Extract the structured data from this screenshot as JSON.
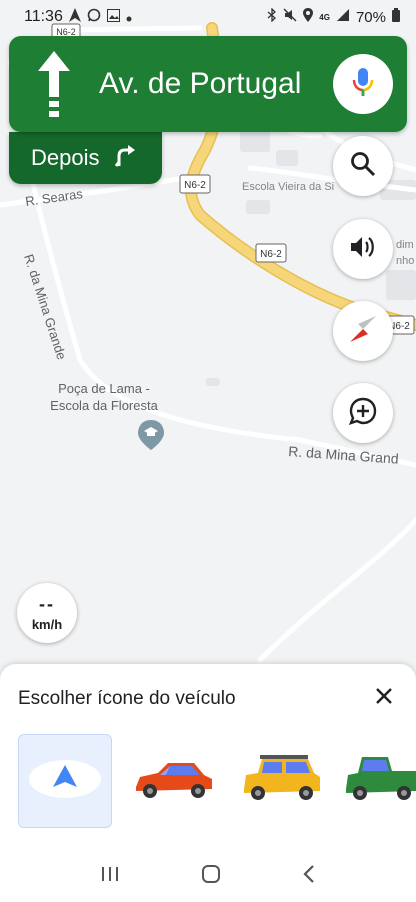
{
  "status_bar": {
    "time": "11:36",
    "battery": "70%",
    "network": "4G",
    "left_icons": [
      "navigation-arrow-icon",
      "whatsapp-icon",
      "gallery-icon",
      "dot-icon"
    ],
    "right_icons": [
      "bluetooth-icon",
      "mute-icon",
      "location-icon",
      "network-icon",
      "signal-icon",
      "battery-icon"
    ]
  },
  "navigation": {
    "direction": "straight",
    "street": "Av. de Portugal",
    "then_label": "Depois",
    "then_icon": "turn-right-icon"
  },
  "map": {
    "labels": {
      "road_n62_a": "N6-2",
      "road_n62_b": "N6-2",
      "road_n62_c": "N6-2",
      "road_n62_top": "N6-2",
      "searas": "R. Searas",
      "mina_grande_vertical": "R. da Mina Grande",
      "mina_grande_horizontal": "R. da Mina Grand",
      "escola_vieira": "Escola Vieira da Si",
      "poca_line1": "Poça de Lama -",
      "poca_line2": "Escola da Floresta",
      "jardim_line1": "dim",
      "jardim_line2": "nho"
    },
    "colors": {
      "background": "#f1f3f4",
      "road": "#ffffff",
      "highway": "#f6d67a",
      "highway_border": "#e8bf4f",
      "building": "#e3e5e8"
    }
  },
  "map_controls": [
    "search-button",
    "sound-button",
    "compass-button",
    "report-button"
  ],
  "speedometer": {
    "value": "--",
    "unit": "km/h"
  },
  "vehicle_sheet": {
    "title": "Escolher ícone do veículo",
    "vehicles": [
      {
        "name": "navigation-arrow",
        "selected": true
      },
      {
        "name": "red-sedan",
        "selected": false
      },
      {
        "name": "yellow-suv",
        "selected": false
      },
      {
        "name": "green-pickup",
        "selected": false
      }
    ]
  },
  "accent_colors": {
    "nav_green": "#1e7e34",
    "nav_green_dark": "#15682b",
    "selected_blue": "#e8f0fe",
    "arrow_blue": "#4285f4"
  }
}
